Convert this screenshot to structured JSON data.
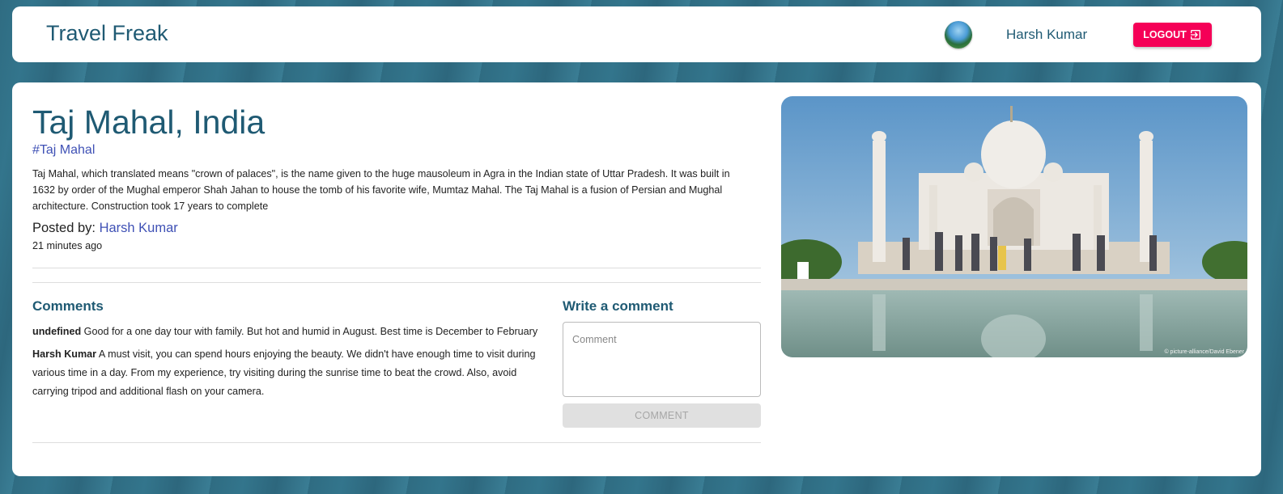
{
  "header": {
    "brand": "Travel Freak",
    "user_name": "Harsh Kumar",
    "logout_label": "LOGOUT"
  },
  "post": {
    "title": "Taj Mahal, India",
    "tag": "#Taj Mahal",
    "description": "Taj Mahal, which translated means \"crown of palaces\", is the name given to the huge mausoleum in Agra in the Indian state of Uttar Pradesh. It was built in 1632 by order of the Mughal emperor Shah Jahan to house the tomb of his favorite wife, Mumtaz Mahal. The Taj Mahal is a fusion of Persian and Mughal architecture. Construction took 17 years to complete",
    "posted_by_label": "Posted by:",
    "author": "Harsh Kumar",
    "time_ago": "21 minutes ago",
    "image_credit": "© picture-alliance/David Ebener"
  },
  "comments": {
    "heading": "Comments",
    "items": [
      {
        "author": "undefined",
        "text": "Good for a one day tour with family. But hot and humid in August. Best time is December to February"
      },
      {
        "author": "Harsh Kumar",
        "text": "A must visit, you can spend hours enjoying the beauty. We didn't have enough time to visit during various time in a day. From my experience, try visiting during the sunrise time to beat the crowd. Also, avoid carrying tripod and additional flash on your camera."
      }
    ]
  },
  "write_comment": {
    "heading": "Write a comment",
    "placeholder": "Comment",
    "button_label": "COMMENT"
  },
  "icons": {
    "logout": "logout-icon",
    "avatar": "avatar"
  },
  "colors": {
    "primary_text": "#1f5a73",
    "link": "#3f51b5",
    "logout_bg": "#f50057"
  }
}
